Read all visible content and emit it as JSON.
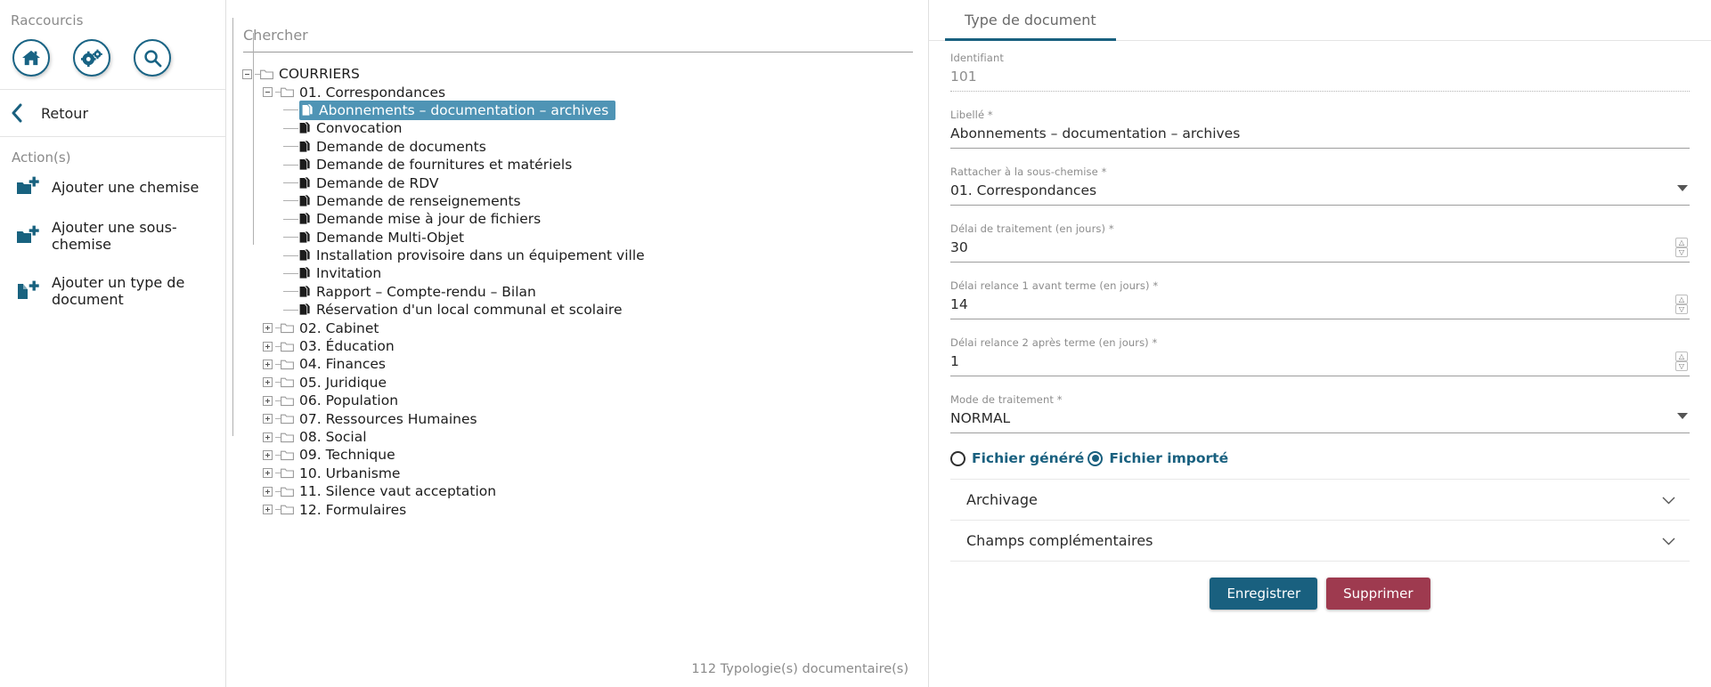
{
  "sidebar": {
    "shortcuts_title": "Raccourcis",
    "shortcut_buttons": [
      {
        "name": "home-icon",
        "label": "Accueil"
      },
      {
        "name": "gears-icon",
        "label": "Paramètres"
      },
      {
        "name": "search-icon",
        "label": "Rechercher"
      }
    ],
    "back_label": "Retour",
    "actions_title": "Action(s)",
    "actions": [
      {
        "label": "Ajouter une chemise",
        "icon": "folder-plus-icon"
      },
      {
        "label": "Ajouter une sous-chemise",
        "icon": "folder-plus-icon"
      },
      {
        "label": "Ajouter un type de document",
        "icon": "file-plus-icon"
      }
    ]
  },
  "center": {
    "search_placeholder": "Chercher",
    "search_value": "",
    "count_text": "112 Typologie(s) documentaire(s)",
    "tree": [
      {
        "label": "COURRIERS",
        "level": 0,
        "type": "folder",
        "state": "expanded",
        "selected": false
      },
      {
        "label": "01. Correspondances",
        "level": 1,
        "type": "folder",
        "state": "expanded",
        "selected": false
      },
      {
        "label": "Abonnements – documentation – archives",
        "level": 2,
        "type": "doc",
        "state": "leaf",
        "selected": true
      },
      {
        "label": "Convocation",
        "level": 2,
        "type": "doc",
        "state": "leaf",
        "selected": false
      },
      {
        "label": "Demande de documents",
        "level": 2,
        "type": "doc",
        "state": "leaf",
        "selected": false
      },
      {
        "label": "Demande de fournitures et matériels",
        "level": 2,
        "type": "doc",
        "state": "leaf",
        "selected": false
      },
      {
        "label": "Demande de RDV",
        "level": 2,
        "type": "doc",
        "state": "leaf",
        "selected": false
      },
      {
        "label": "Demande de renseignements",
        "level": 2,
        "type": "doc",
        "state": "leaf",
        "selected": false
      },
      {
        "label": "Demande mise à jour de fichiers",
        "level": 2,
        "type": "doc",
        "state": "leaf",
        "selected": false
      },
      {
        "label": "Demande Multi-Objet",
        "level": 2,
        "type": "doc",
        "state": "leaf",
        "selected": false
      },
      {
        "label": "Installation provisoire dans un équipement ville",
        "level": 2,
        "type": "doc",
        "state": "leaf",
        "selected": false
      },
      {
        "label": "Invitation",
        "level": 2,
        "type": "doc",
        "state": "leaf",
        "selected": false
      },
      {
        "label": "Rapport – Compte-rendu – Bilan",
        "level": 2,
        "type": "doc",
        "state": "leaf",
        "selected": false
      },
      {
        "label": "Réservation d'un local communal et scolaire",
        "level": 2,
        "type": "doc",
        "state": "leaf-last",
        "selected": false
      },
      {
        "label": "02. Cabinet",
        "level": 1,
        "type": "folder",
        "state": "collapsed",
        "selected": false
      },
      {
        "label": "03. Éducation",
        "level": 1,
        "type": "folder",
        "state": "collapsed",
        "selected": false
      },
      {
        "label": "04. Finances",
        "level": 1,
        "type": "folder",
        "state": "collapsed",
        "selected": false
      },
      {
        "label": "05. Juridique",
        "level": 1,
        "type": "folder",
        "state": "collapsed",
        "selected": false
      },
      {
        "label": "06. Population",
        "level": 1,
        "type": "folder",
        "state": "collapsed",
        "selected": false
      },
      {
        "label": "07. Ressources Humaines",
        "level": 1,
        "type": "folder",
        "state": "collapsed",
        "selected": false
      },
      {
        "label": "08. Social",
        "level": 1,
        "type": "folder",
        "state": "collapsed",
        "selected": false
      },
      {
        "label": "09. Technique",
        "level": 1,
        "type": "folder",
        "state": "collapsed",
        "selected": false
      },
      {
        "label": "10. Urbanisme",
        "level": 1,
        "type": "folder",
        "state": "collapsed",
        "selected": false
      },
      {
        "label": "11. Silence vaut acceptation",
        "level": 1,
        "type": "folder",
        "state": "collapsed",
        "selected": false
      },
      {
        "label": "12. Formulaires",
        "level": 1,
        "type": "folder",
        "state": "collapsed",
        "selected": false
      }
    ]
  },
  "right": {
    "tab_label": "Type de document",
    "fields": {
      "identifiant": {
        "label": "Identifiant",
        "value": "101"
      },
      "libelle": {
        "label": "Libellé *",
        "value": "Abonnements – documentation – archives"
      },
      "rattacher": {
        "label": "Rattacher à la sous-chemise *",
        "value": "01. Correspondances"
      },
      "delai_traitement": {
        "label": "Délai de traitement (en jours) *",
        "value": "30"
      },
      "relance1": {
        "label": "Délai relance 1 avant terme (en jours) *",
        "value": "14"
      },
      "relance2": {
        "label": "Délai relance 2 après terme (en jours) *",
        "value": "1"
      },
      "mode": {
        "label": "Mode de traitement *",
        "value": "NORMAL"
      }
    },
    "radios": [
      {
        "label": "Fichier généré",
        "selected": false
      },
      {
        "label": "Fichier importé",
        "selected": true
      }
    ],
    "accordions": [
      {
        "label": "Archivage"
      },
      {
        "label": "Champs complémentaires"
      }
    ],
    "buttons": {
      "save": "Enregistrer",
      "delete": "Supprimer"
    }
  },
  "colors": {
    "accent": "#19607f",
    "selection": "#4f94b5",
    "danger": "#9e3a4f"
  }
}
